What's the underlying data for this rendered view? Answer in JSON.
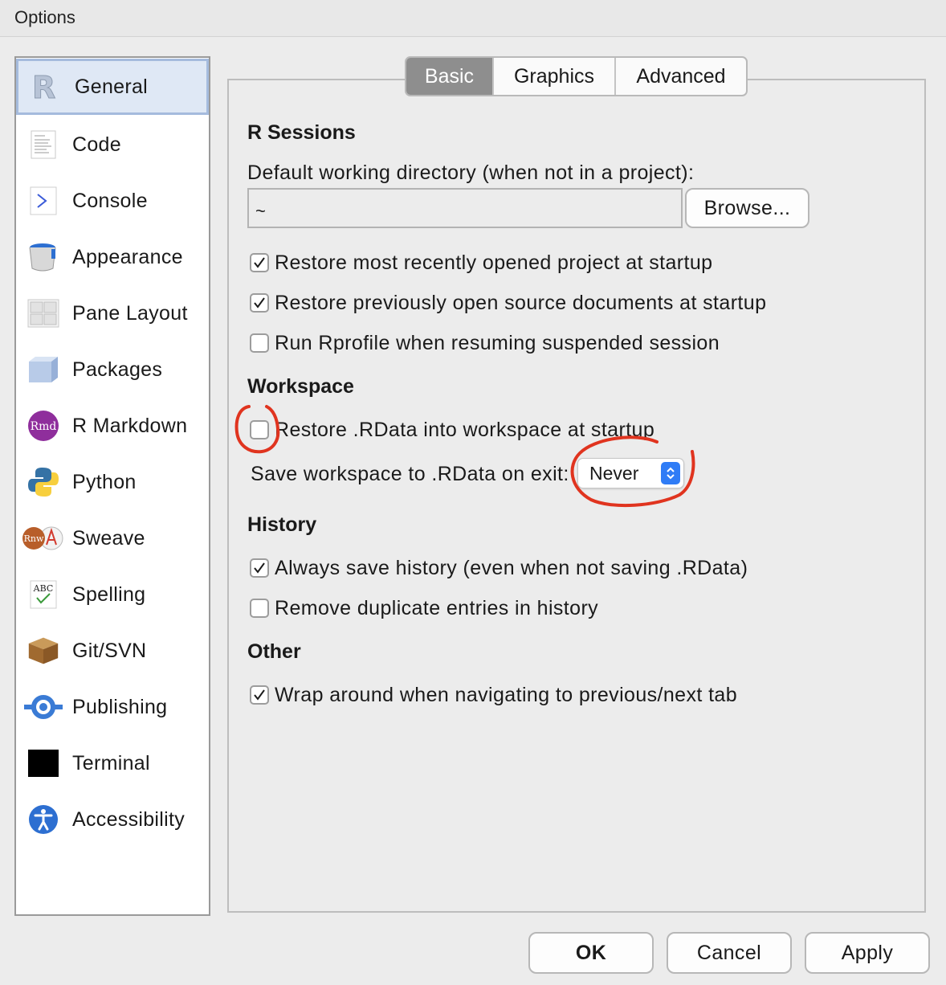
{
  "window": {
    "title": "Options"
  },
  "sidebar": {
    "items": [
      {
        "label": "General",
        "icon": "r-logo-icon",
        "selected": true
      },
      {
        "label": "Code",
        "icon": "code-icon"
      },
      {
        "label": "Console",
        "icon": "console-icon"
      },
      {
        "label": "Appearance",
        "icon": "paint-bucket-icon"
      },
      {
        "label": "Pane Layout",
        "icon": "pane-layout-icon"
      },
      {
        "label": "Packages",
        "icon": "package-cube-icon"
      },
      {
        "label": "R Markdown",
        "icon": "rmd-icon"
      },
      {
        "label": "Python",
        "icon": "python-icon"
      },
      {
        "label": "Sweave",
        "icon": "sweave-icon"
      },
      {
        "label": "Spelling",
        "icon": "spelling-icon"
      },
      {
        "label": "Git/SVN",
        "icon": "git-box-icon"
      },
      {
        "label": "Publishing",
        "icon": "publishing-icon"
      },
      {
        "label": "Terminal",
        "icon": "terminal-icon"
      },
      {
        "label": "Accessibility",
        "icon": "accessibility-icon"
      }
    ]
  },
  "tabs": [
    {
      "label": "Basic",
      "active": true
    },
    {
      "label": "Graphics"
    },
    {
      "label": "Advanced"
    }
  ],
  "sections": {
    "sessions": {
      "heading": "R Sessions",
      "dir_label": "Default working directory (when not in a project):",
      "dir_value": "~",
      "browse_label": "Browse...",
      "opt_restore_project": {
        "label": "Restore most recently opened project at startup",
        "checked": true
      },
      "opt_restore_docs": {
        "label": "Restore previously open source documents at startup",
        "checked": true
      },
      "opt_run_rprofile": {
        "label": "Run Rprofile when resuming suspended session",
        "checked": false
      }
    },
    "workspace": {
      "heading": "Workspace",
      "opt_restore_rdata": {
        "label": "Restore .RData into workspace at startup",
        "checked": false
      },
      "save_label": "Save workspace to .RData on exit:",
      "save_value": "Never"
    },
    "history": {
      "heading": "History",
      "opt_always_save": {
        "label": "Always save history (even when not saving .RData)",
        "checked": true
      },
      "opt_remove_dupes": {
        "label": "Remove duplicate entries in history",
        "checked": false
      }
    },
    "other": {
      "heading": "Other",
      "opt_wrap": {
        "label": "Wrap around when navigating to previous/next tab",
        "checked": true
      }
    }
  },
  "footer": {
    "ok_label": "OK",
    "cancel_label": "Cancel",
    "apply_label": "Apply"
  },
  "colors": {
    "annotation": "#e0341f",
    "accent": "#2f7cf6",
    "selected_bg": "#dfe8f5"
  }
}
